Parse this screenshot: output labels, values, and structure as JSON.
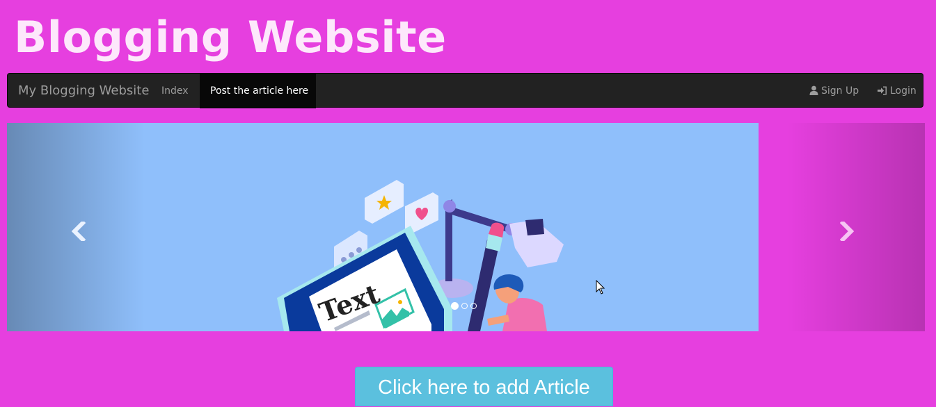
{
  "header": {
    "title": "Blogging Website"
  },
  "navbar": {
    "brand": "My Blogging Website",
    "links": [
      "Index",
      "Post the article here"
    ],
    "active_link": "Post the article here",
    "right_links": [
      {
        "label": "Sign Up",
        "icon": "user-icon"
      },
      {
        "label": "Login",
        "icon": "login-icon"
      }
    ]
  },
  "carousel": {
    "slide_text": "Text",
    "indicator_count": 3,
    "active_indicator": 1,
    "prev_icon": "chevron-left-icon",
    "next_icon": "chevron-right-icon"
  },
  "main": {
    "add_article_label": "Click here to add Article"
  },
  "colors": {
    "page_background": "#e63fdf",
    "navbar_background": "#222222",
    "slide_background": "#8fbffb",
    "button_background": "#5bc0de"
  }
}
